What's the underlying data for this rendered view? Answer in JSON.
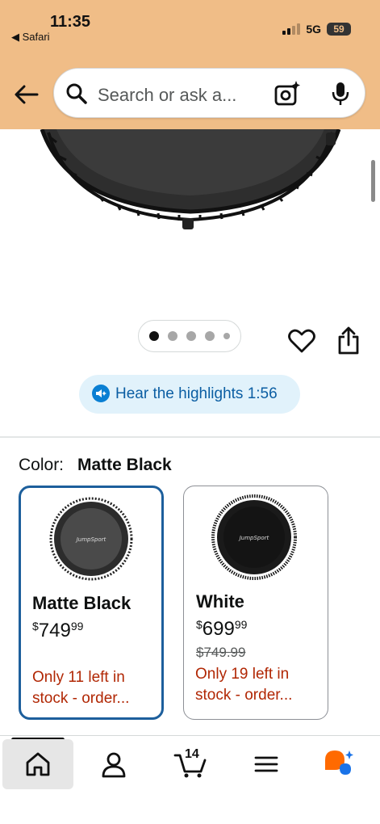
{
  "status_bar": {
    "time": "11:35",
    "back_app": "◀ Safari",
    "network": "5G",
    "battery": "59"
  },
  "search": {
    "placeholder": "Search or ask a..."
  },
  "carousel": {
    "total_pages": 5,
    "active_page": 1
  },
  "highlights": {
    "label": "Hear the highlights 1:56"
  },
  "color_selector": {
    "label": "Color:",
    "selected": "Matte Black",
    "options": [
      {
        "name": "Matte Black",
        "price_symbol": "$",
        "price_whole": "749",
        "price_cents": "99",
        "list_price": "",
        "stock": "Only 11 left in stock - order...",
        "selected": true
      },
      {
        "name": "White",
        "price_symbol": "$",
        "price_whole": "699",
        "price_cents": "99",
        "list_price": "$749.99",
        "stock": "Only 19 left in stock - order...",
        "selected": false
      }
    ]
  },
  "bottom_nav": {
    "items": [
      "home-icon",
      "account-icon",
      "cart-icon",
      "menu-icon",
      "rufus-icon"
    ],
    "cart_count": "14",
    "active": "home"
  },
  "colors": {
    "header": "#f0bd87",
    "selected_border": "#1d5f9c",
    "stock_red": "#b12704",
    "highlight_blue": "#0a7fd3"
  }
}
